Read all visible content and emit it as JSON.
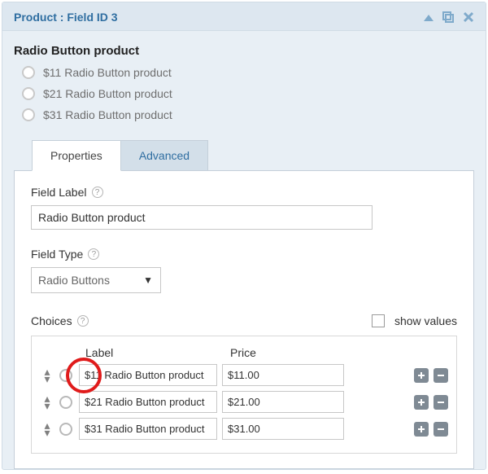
{
  "panel": {
    "title": "Product : Field ID 3"
  },
  "preview": {
    "title": "Radio Button product",
    "options": [
      {
        "text": "$11 Radio Button product"
      },
      {
        "text": "$21 Radio Button product"
      },
      {
        "text": "$31 Radio Button product"
      }
    ]
  },
  "tabs": {
    "properties_label": "Properties",
    "advanced_label": "Advanced"
  },
  "properties": {
    "field_label_label": "Field Label",
    "field_label_value": "Radio Button product",
    "field_type_label": "Field Type",
    "field_type_value": "Radio Buttons",
    "choices_label": "Choices",
    "show_values_label": "show values",
    "columns": {
      "label": "Label",
      "price": "Price"
    },
    "rows": [
      {
        "label": "$11 Radio Button product",
        "price": "$11.00"
      },
      {
        "label": "$21 Radio Button product",
        "price": "$21.00"
      },
      {
        "label": "$31 Radio Button product",
        "price": "$31.00"
      }
    ]
  }
}
